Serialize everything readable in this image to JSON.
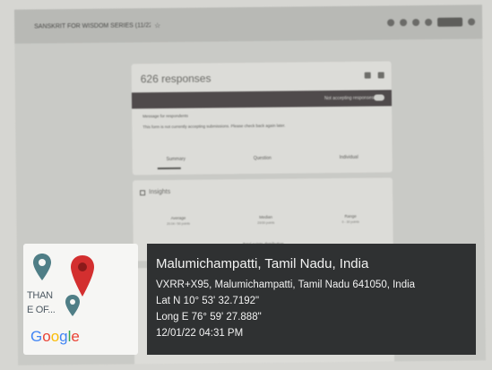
{
  "browser": {
    "doc_title": "SANSKRIT FOR WISDOM SERIES (11/22)",
    "star": "☆"
  },
  "form": {
    "responses_title": "626 responses",
    "accepting_label": "Not accepting responses",
    "message_label": "Message for respondents",
    "message_text": "This form is not currently accepting submissions. Please check back again later.",
    "tabs": [
      "Summary",
      "Question",
      "Individual"
    ],
    "insights_title": "Insights",
    "stats": [
      {
        "label": "Average",
        "sub": "20.04 / 50 points"
      },
      {
        "label": "Median",
        "sub": "20/30 points"
      },
      {
        "label": "Range",
        "sub": "0 - 30 points"
      }
    ],
    "distribution_label": "Total points distribution"
  },
  "map": {
    "label_line1": "THAN",
    "label_line2": "E OF...",
    "google_letters": [
      "G",
      "o",
      "o",
      "g",
      "l",
      "e"
    ],
    "google_colors": [
      "#4285F4",
      "#EA4335",
      "#FBBC05",
      "#4285F4",
      "#34A853",
      "#EA4335"
    ],
    "pin_red": "#d32f2f",
    "pin_teal": "#4f7e86"
  },
  "gps": {
    "place": "Malumichampatti, Tamil Nadu, India",
    "address": "VXRR+X95, Malumichampatti, Tamil Nadu 641050, India",
    "lat": "Lat N 10° 53' 32.7192\"",
    "long": "Long E 76° 59' 27.888\"",
    "datetime": "12/01/22 04:31 PM"
  }
}
